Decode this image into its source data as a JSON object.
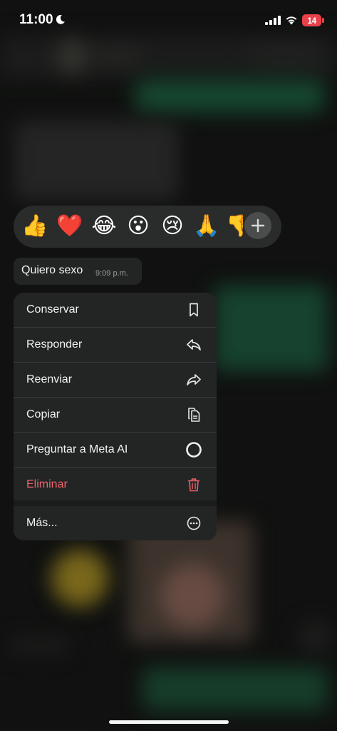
{
  "status_bar": {
    "time": "11:00",
    "battery": "14"
  },
  "reactions": [
    {
      "emoji": "👍",
      "name": "thumbs-up"
    },
    {
      "emoji": "❤️",
      "name": "red-heart"
    },
    {
      "emoji": "😂",
      "name": "tears-of-joy"
    },
    {
      "emoji": "😮",
      "name": "open-mouth"
    },
    {
      "emoji": "😢",
      "name": "crying-face"
    },
    {
      "emoji": "🙏",
      "name": "folded-hands"
    },
    {
      "emoji": "👎",
      "name": "thumbs-down"
    }
  ],
  "message": {
    "text": "Quiero sexo",
    "time": "9:09 p.m."
  },
  "menu": {
    "items": [
      {
        "label": "Conservar",
        "icon": "bookmark-icon"
      },
      {
        "label": "Responder",
        "icon": "reply-icon"
      },
      {
        "label": "Reenviar",
        "icon": "forward-icon"
      },
      {
        "label": "Copiar",
        "icon": "copy-icon"
      },
      {
        "label": "Preguntar a Meta AI",
        "icon": "meta-ai-icon"
      },
      {
        "label": "Eliminar",
        "icon": "trash-icon"
      },
      {
        "label": "Más...",
        "icon": "more-icon"
      }
    ]
  },
  "colors": {
    "danger": "#f0626a",
    "menu_background": "#232525",
    "battery_low": "#e8414a"
  }
}
